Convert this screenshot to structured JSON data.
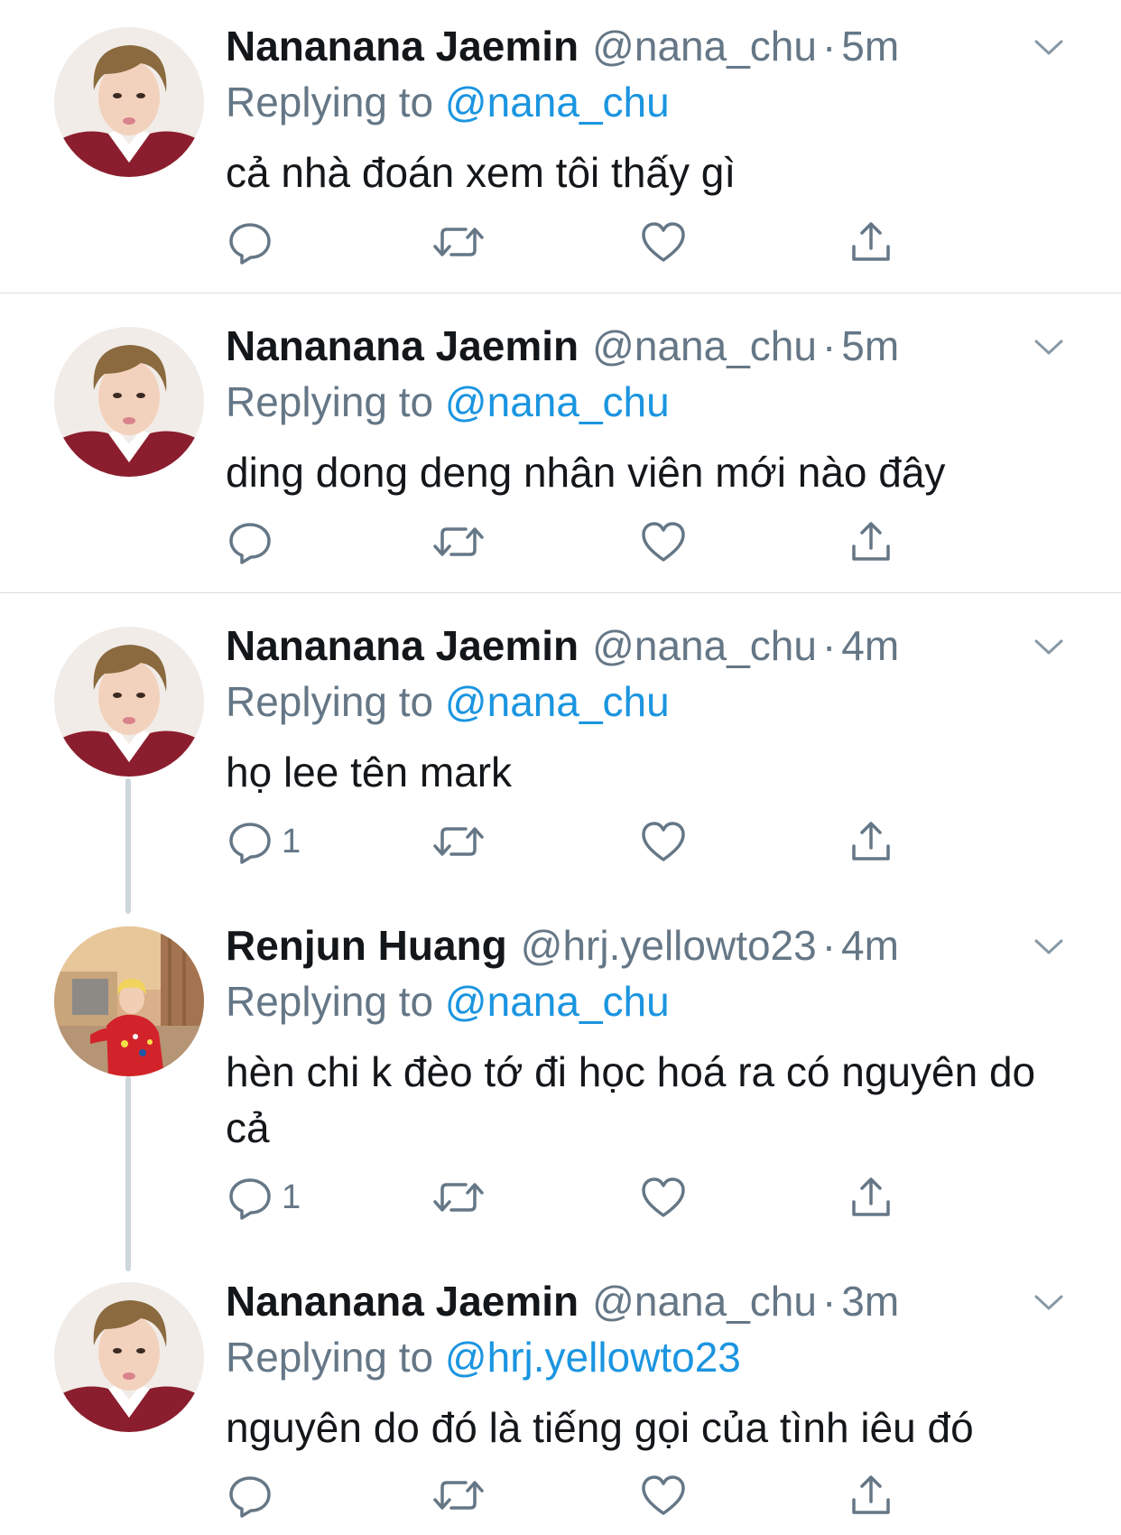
{
  "colors": {
    "name": "#14171a",
    "secondary": "#657786",
    "link": "#1b95e0",
    "divider": "#d9dde0",
    "thread_line": "#ccd6dd"
  },
  "icons": {
    "reply": "reply-bubble-icon",
    "retweet": "retweet-icon",
    "like": "heart-icon",
    "share": "share-upload-icon",
    "menu": "chevron-down-icon"
  },
  "tweets": [
    {
      "name": "Nananana Jaemin",
      "handle": "@nana_chu",
      "separator": "·",
      "time": "5m",
      "replying_prefix": "Replying to",
      "replying_to": "@nana_chu",
      "text": "cả nhà đoán xem tôi thấy gì",
      "reply_count": ""
    },
    {
      "name": "Nananana Jaemin",
      "handle": "@nana_chu",
      "separator": "·",
      "time": "5m",
      "replying_prefix": "Replying to",
      "replying_to": "@nana_chu",
      "text": "ding dong deng nhân viên mới nào đây",
      "reply_count": ""
    },
    {
      "name": "Nananana Jaemin",
      "handle": "@nana_chu",
      "separator": "·",
      "time": "4m",
      "replying_prefix": "Replying to",
      "replying_to": "@nana_chu",
      "text": "họ lee tên mark",
      "reply_count": "1"
    },
    {
      "name": "Renjun Huang",
      "handle": "@hrj.yellowto23",
      "separator": "·",
      "time": "4m",
      "replying_prefix": "Replying to",
      "replying_to": "@nana_chu",
      "text": "hèn chi k đèo tớ đi học hoá ra có nguyên do cả",
      "reply_count": "1"
    },
    {
      "name": "Nananana Jaemin",
      "handle": "@nana_chu",
      "separator": "·",
      "time": "3m",
      "replying_prefix": "Replying to",
      "replying_to": "@hrj.yellowto23",
      "text": "nguyên do đó là tiếng gọi của tình iêu đó",
      "reply_count": ""
    }
  ]
}
